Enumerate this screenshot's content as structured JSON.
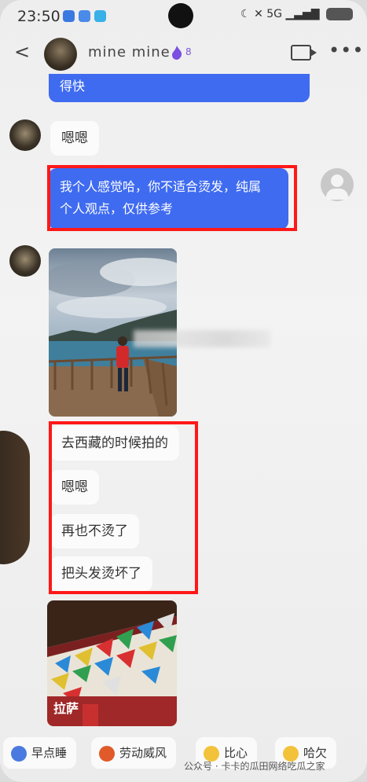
{
  "status_bar": {
    "time": "23:50",
    "signal_text": "5G",
    "battery": ""
  },
  "header": {
    "back_label": "<",
    "contact_name": "mine  mine",
    "level": "8",
    "more_label": "•••"
  },
  "messages": [
    {
      "side": "out",
      "text": "得快"
    },
    {
      "side": "in",
      "text": "嗯嗯"
    },
    {
      "side": "out",
      "line1": "我个人感觉哈，你不适合烫发，纯属",
      "line2": "个人观点，仅供参考"
    },
    {
      "side": "in",
      "type": "image",
      "desc": "lake-photo"
    },
    {
      "side": "in",
      "text": "去西藏的时候拍的"
    },
    {
      "side": "in",
      "text": "嗯嗯"
    },
    {
      "side": "in",
      "text": "再也不烫了"
    },
    {
      "side": "in",
      "text": "把头发烫坏了"
    },
    {
      "side": "in",
      "type": "image",
      "desc": "prayer-flags-photo"
    }
  ],
  "photo2_sign": "拉萨",
  "quick_replies": [
    "早点睡",
    "劳动威风",
    "比心",
    "哈欠"
  ],
  "watermark": "公众号 · 卡卡的瓜田网络吃瓜之家",
  "colors": {
    "bubble_out": "#3f6bf0",
    "highlight": "#ff1818"
  }
}
